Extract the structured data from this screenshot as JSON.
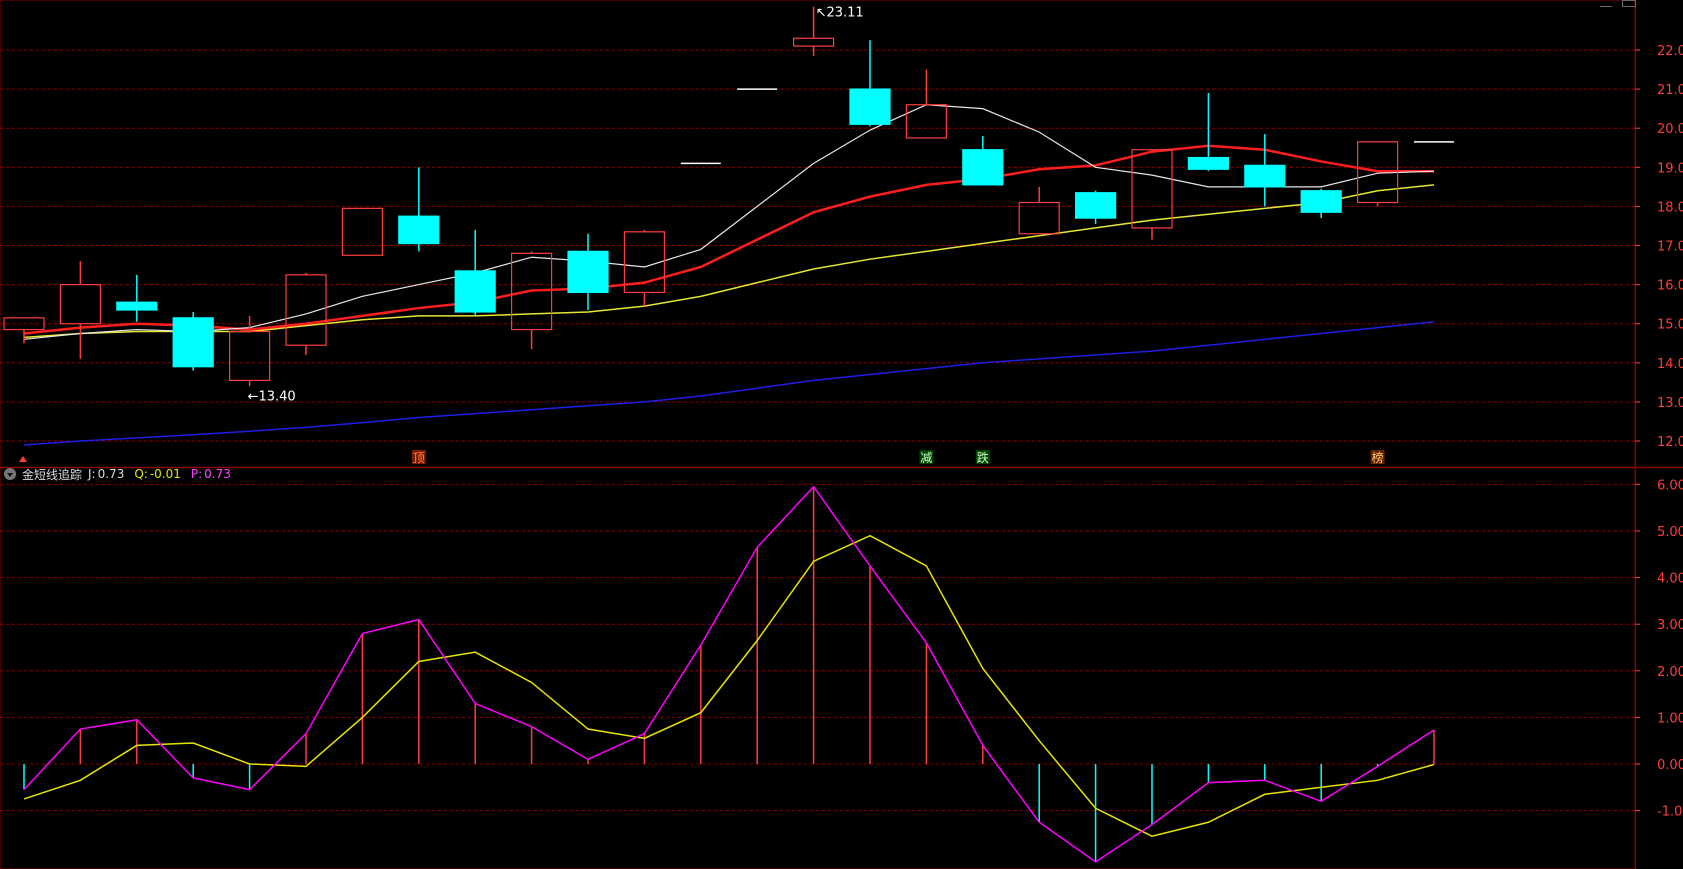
{
  "colors": {
    "background": "#000000",
    "up": "#ff3c3c",
    "down": "#00ffff",
    "grid": "#8a0000",
    "axis_text": "#ff3c3c",
    "ma_white": "#e6e6e6",
    "ma_red": "#ff1e1e",
    "ma_yellow": "#e6e632",
    "ma_blue": "#1e1ee6",
    "j_line": "#ff00ff",
    "q_line": "#e6e600",
    "annotation": "#ffffff"
  },
  "indicator": {
    "name": "金短线追踪",
    "j_label": "J:",
    "j_value": "0.73",
    "q_label": "Q:",
    "q_value": "-0.01",
    "p_label": "P:",
    "p_value": "0.73"
  },
  "signals": [
    {
      "index": 7,
      "text": "顶",
      "color": "#ff8844",
      "bg": "#7a1a00"
    },
    {
      "index": 16,
      "text": "减",
      "color": "#ccffcc",
      "bg": "#004400"
    },
    {
      "index": 17,
      "text": "跌",
      "color": "#ccffcc",
      "bg": "#004400"
    },
    {
      "index": 24,
      "text": "榜",
      "color": "#ffcc66",
      "bg": "#662200"
    }
  ],
  "annotations": {
    "high": "23.11",
    "low": "13.40"
  },
  "chart_data": [
    {
      "type": "candlestick",
      "ylim": [
        11.6,
        23.2
      ],
      "yticks": [
        12.0,
        13.0,
        14.0,
        15.0,
        16.0,
        17.0,
        18.0,
        19.0,
        20.0,
        21.0,
        22.0
      ],
      "ytick_labels": [
        "12.00",
        "13.00",
        "14.00",
        "15.00",
        "16.00",
        "17.00",
        "18.00",
        "19.00",
        "20.00",
        "21.00",
        "22.00"
      ],
      "grid": true,
      "candles": [
        {
          "o": 14.85,
          "h": 15.15,
          "l": 14.5,
          "c": 15.15
        },
        {
          "o": 15.0,
          "h": 16.6,
          "l": 14.1,
          "c": 16.0
        },
        {
          "o": 15.55,
          "h": 16.25,
          "l": 15.05,
          "c": 15.35
        },
        {
          "o": 15.15,
          "h": 15.3,
          "l": 13.8,
          "c": 13.9
        },
        {
          "o": 13.55,
          "h": 15.2,
          "l": 13.4,
          "c": 14.8
        },
        {
          "o": 14.45,
          "h": 16.3,
          "l": 14.2,
          "c": 16.25
        },
        {
          "o": 16.75,
          "h": 17.95,
          "l": 16.75,
          "c": 17.95
        },
        {
          "o": 17.75,
          "h": 19.0,
          "l": 16.85,
          "c": 17.05
        },
        {
          "o": 16.35,
          "h": 17.4,
          "l": 15.2,
          "c": 15.3
        },
        {
          "o": 14.85,
          "h": 16.85,
          "l": 14.35,
          "c": 16.8
        },
        {
          "o": 16.85,
          "h": 17.3,
          "l": 15.35,
          "c": 15.8
        },
        {
          "o": 15.8,
          "h": 17.4,
          "l": 15.45,
          "c": 17.35
        },
        {
          "o": 19.1,
          "h": 19.1,
          "l": 19.1,
          "c": 19.1
        },
        {
          "o": 21.0,
          "h": 21.0,
          "l": 21.0,
          "c": 21.0
        },
        {
          "o": 22.1,
          "h": 23.11,
          "l": 21.85,
          "c": 22.3
        },
        {
          "o": 21.0,
          "h": 22.25,
          "l": 20.05,
          "c": 20.1
        },
        {
          "o": 19.75,
          "h": 21.5,
          "l": 19.75,
          "c": 20.6
        },
        {
          "o": 19.45,
          "h": 19.8,
          "l": 18.55,
          "c": 18.55
        },
        {
          "o": 17.3,
          "h": 18.5,
          "l": 17.3,
          "c": 18.1
        },
        {
          "o": 18.35,
          "h": 18.4,
          "l": 17.55,
          "c": 17.7
        },
        {
          "o": 17.45,
          "h": 19.45,
          "l": 17.15,
          "c": 19.45
        },
        {
          "o": 19.25,
          "h": 20.9,
          "l": 18.9,
          "c": 18.95
        },
        {
          "o": 19.05,
          "h": 19.85,
          "l": 18.0,
          "c": 18.5
        },
        {
          "o": 18.4,
          "h": 18.45,
          "l": 17.7,
          "c": 17.85
        },
        {
          "o": 18.1,
          "h": 19.65,
          "l": 18.0,
          "c": 19.65
        },
        {
          "o": 19.65,
          "h": 19.65,
          "l": 19.65,
          "c": 19.65
        }
      ],
      "ma_white": [
        14.6,
        14.75,
        14.85,
        14.8,
        14.9,
        15.25,
        15.7,
        16.0,
        16.3,
        16.7,
        16.6,
        16.45,
        16.9,
        18.0,
        19.1,
        19.95,
        20.6,
        20.5,
        19.9,
        19.0,
        18.8,
        18.5,
        18.5,
        18.5,
        18.85,
        18.9
      ],
      "ma_red": [
        14.75,
        14.9,
        15.0,
        14.95,
        14.85,
        15.0,
        15.2,
        15.4,
        15.55,
        15.85,
        15.9,
        16.05,
        16.45,
        17.15,
        17.85,
        18.25,
        18.55,
        18.7,
        18.95,
        19.05,
        19.4,
        19.55,
        19.45,
        19.15,
        18.9,
        18.9
      ],
      "ma_yellow": [
        14.65,
        14.75,
        14.8,
        14.8,
        14.8,
        14.95,
        15.1,
        15.2,
        15.2,
        15.25,
        15.3,
        15.45,
        15.7,
        16.05,
        16.4,
        16.65,
        16.85,
        17.05,
        17.25,
        17.45,
        17.65,
        17.8,
        17.95,
        18.1,
        18.4,
        18.55
      ],
      "ma_blue": [
        11.9,
        12.0,
        12.08,
        12.16,
        12.25,
        12.35,
        12.47,
        12.6,
        12.7,
        12.8,
        12.9,
        13.0,
        13.15,
        13.35,
        13.55,
        13.7,
        13.85,
        14.0,
        14.1,
        14.2,
        14.3,
        14.45,
        14.6,
        14.75,
        14.9,
        15.05
      ]
    },
    {
      "type": "line",
      "name": "金短线追踪",
      "ylim": [
        -2.2,
        6.4
      ],
      "yticks": [
        -1.0,
        0.0,
        1.0,
        2.0,
        3.0,
        4.0,
        5.0,
        6.0
      ],
      "ytick_labels": [
        "-1.00",
        "0.00",
        "1.00",
        "2.00",
        "3.00",
        "4.00",
        "5.00",
        "6.00"
      ],
      "grid": true,
      "series": [
        {
          "name": "J",
          "values": [
            -0.55,
            0.75,
            0.95,
            -0.3,
            -0.55,
            0.65,
            2.8,
            3.1,
            1.3,
            0.8,
            0.1,
            0.65,
            2.55,
            4.65,
            5.95,
            4.25,
            2.6,
            0.4,
            -1.25,
            -2.1,
            -1.3,
            -0.4,
            -0.35,
            -0.8,
            -0.05,
            0.73
          ]
        },
        {
          "name": "Q",
          "values": [
            -0.75,
            -0.35,
            0.4,
            0.45,
            0.0,
            -0.05,
            1.0,
            2.2,
            2.4,
            1.75,
            0.75,
            0.55,
            1.1,
            2.65,
            4.35,
            4.9,
            4.25,
            2.05,
            0.5,
            -0.95,
            -1.55,
            -1.25,
            -0.65,
            -0.5,
            -0.35,
            -0.01
          ]
        }
      ],
      "bars": [
        -0.55,
        0.75,
        0.95,
        -0.3,
        -0.55,
        0.65,
        2.8,
        3.1,
        1.3,
        0.8,
        0.1,
        0.65,
        2.55,
        4.65,
        5.95,
        4.25,
        2.6,
        0.4,
        -1.25,
        -2.1,
        -1.3,
        -0.4,
        -0.35,
        -0.8,
        -0.05,
        0.73
      ]
    }
  ]
}
